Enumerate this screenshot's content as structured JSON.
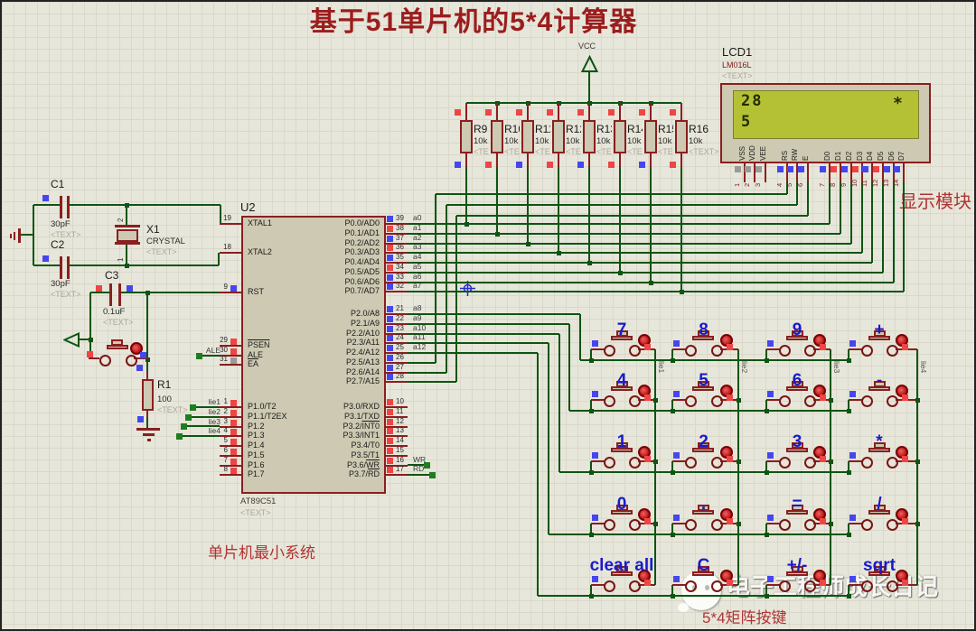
{
  "title": "基于51单片机的5*4计算器",
  "captions": {
    "display_module": "显示模块",
    "mcu_system": "单片机最小系统",
    "keypad": "5*4矩阵按键"
  },
  "watermark": "电子工程师成长日记",
  "power": {
    "vcc": "VCC"
  },
  "lcd": {
    "ref": "LCD1",
    "model": "LM016L",
    "placeholder": "<TEXT>",
    "screen": {
      "line1": "28",
      "line2": "5",
      "symbol": "*"
    },
    "pins": [
      {
        "num": "1",
        "name": "VSS",
        "marker": "gray"
      },
      {
        "num": "2",
        "name": "VDD",
        "marker": "gray"
      },
      {
        "num": "3",
        "name": "VEE",
        "marker": "gray"
      },
      {
        "num": "4",
        "name": "RS",
        "marker": "blue"
      },
      {
        "num": "5",
        "name": "RW",
        "marker": "blue"
      },
      {
        "num": "6",
        "name": "E",
        "marker": "blue"
      },
      {
        "num": "7",
        "name": "D0",
        "marker": "blue"
      },
      {
        "num": "8",
        "name": "D1",
        "marker": "red"
      },
      {
        "num": "9",
        "name": "D2",
        "marker": "blue"
      },
      {
        "num": "10",
        "name": "D3",
        "marker": "red"
      },
      {
        "num": "11",
        "name": "D4",
        "marker": "blue"
      },
      {
        "num": "12",
        "name": "D5",
        "marker": "red"
      },
      {
        "num": "13",
        "name": "D6",
        "marker": "blue"
      },
      {
        "num": "14",
        "name": "D7",
        "marker": "blue"
      }
    ]
  },
  "resistor_bank": {
    "value": "10k",
    "placeholder": "<TEXT>",
    "top_marker": "red",
    "items": [
      {
        "ref": "R9",
        "bottom_marker": "blue"
      },
      {
        "ref": "R10",
        "bottom_marker": "red"
      },
      {
        "ref": "R11",
        "bottom_marker": "blue"
      },
      {
        "ref": "R12",
        "bottom_marker": "red"
      },
      {
        "ref": "R13",
        "bottom_marker": "blue"
      },
      {
        "ref": "R14",
        "bottom_marker": "red"
      },
      {
        "ref": "R15",
        "bottom_marker": "blue"
      },
      {
        "ref": "R16",
        "bottom_marker": "red"
      }
    ]
  },
  "mcu": {
    "ref": "U2",
    "part": "AT89C51",
    "placeholder": "<TEXT>",
    "left_pins": [
      {
        "num": "19",
        "name": "XTAL1"
      },
      {
        "num": "18",
        "name": "XTAL2"
      },
      {
        "num": "9",
        "name": "RST",
        "marker": "blue"
      },
      {
        "num": "29",
        "name": "PSEN",
        "overline": true,
        "marker": "red"
      },
      {
        "num": "30",
        "name": "ALE",
        "marker": "red",
        "net": "ALE"
      },
      {
        "num": "31",
        "name": "EA",
        "overline": true,
        "marker": "gray"
      },
      {
        "num": "1",
        "name": "P1.0/T2",
        "marker": "red",
        "net": "lie1"
      },
      {
        "num": "2",
        "name": "P1.1/T2EX",
        "marker": "red",
        "net": "lie2"
      },
      {
        "num": "3",
        "name": "P1.2",
        "marker": "red",
        "net": "lie3"
      },
      {
        "num": "4",
        "name": "P1.3",
        "marker": "red",
        "net": "lie4"
      },
      {
        "num": "5",
        "name": "P1.4",
        "marker": "red"
      },
      {
        "num": "6",
        "name": "P1.5",
        "marker": "red"
      },
      {
        "num": "7",
        "name": "P1.6",
        "marker": "red"
      },
      {
        "num": "8",
        "name": "P1.7",
        "marker": "red"
      }
    ],
    "right_pins": [
      {
        "num": "39",
        "name": "P0.0/AD0",
        "marker": "blue",
        "net": "a0"
      },
      {
        "num": "38",
        "name": "P0.1/AD1",
        "marker": "red",
        "net": "a1"
      },
      {
        "num": "37",
        "name": "P0.2/AD2",
        "marker": "blue",
        "net": "a2"
      },
      {
        "num": "36",
        "name": "P0.3/AD3",
        "marker": "red",
        "net": "a3"
      },
      {
        "num": "35",
        "name": "P0.4/AD4",
        "marker": "blue",
        "net": "a4"
      },
      {
        "num": "34",
        "name": "P0.5/AD5",
        "marker": "red",
        "net": "a5"
      },
      {
        "num": "33",
        "name": "P0.6/AD6",
        "marker": "blue",
        "net": "a6"
      },
      {
        "num": "32",
        "name": "P0.7/AD7",
        "marker": "blue",
        "net": "a7"
      },
      {
        "num": "21",
        "name": "P2.0/A8",
        "marker": "blue",
        "net": "a8"
      },
      {
        "num": "22",
        "name": "P2.1/A9",
        "marker": "blue",
        "net": "a9"
      },
      {
        "num": "23",
        "name": "P2.2/A10",
        "marker": "blue",
        "net": "a10"
      },
      {
        "num": "24",
        "name": "P2.3/A11",
        "marker": "blue",
        "net": "a11"
      },
      {
        "num": "25",
        "name": "P2.4/A12",
        "marker": "blue",
        "net": "a12"
      },
      {
        "num": "26",
        "name": "P2.5/A13",
        "marker": "blue"
      },
      {
        "num": "27",
        "name": "P2.6/A14",
        "marker": "blue"
      },
      {
        "num": "28",
        "name": "P2.7/A15",
        "marker": "blue"
      },
      {
        "num": "10",
        "name": "P3.0/RXD",
        "marker": "red"
      },
      {
        "num": "11",
        "name": "P3.1/TXD",
        "marker": "red"
      },
      {
        "num": "12",
        "name": "P3.2/INT0",
        "overline_suffix": "INT0",
        "marker": "red"
      },
      {
        "num": "13",
        "name": "P3.3/INT1",
        "marker": "red"
      },
      {
        "num": "14",
        "name": "P3.4/T0",
        "marker": "red"
      },
      {
        "num": "15",
        "name": "P3.5/T1",
        "marker": "red"
      },
      {
        "num": "16",
        "name": "P3.6/WR",
        "overline_suffix": "WR",
        "marker": "red",
        "net": "WR"
      },
      {
        "num": "17",
        "name": "P3.7/RD",
        "overline_suffix": "RD",
        "marker": "red",
        "net": "RD"
      }
    ]
  },
  "oscillator": {
    "c1": {
      "ref": "C1",
      "value": "30pF",
      "placeholder": "<TEXT>"
    },
    "c2": {
      "ref": "C2",
      "value": "30pF",
      "placeholder": "<TEXT>"
    },
    "x1": {
      "ref": "X1",
      "value": "CRYSTAL",
      "placeholder": "<TEXT>",
      "pin_top": "2",
      "pin_bottom": "1"
    }
  },
  "reset": {
    "c3": {
      "ref": "C3",
      "value": "0.1uF",
      "placeholder": "<TEXT>"
    },
    "r1": {
      "ref": "R1",
      "value": "100",
      "placeholder": "<TEXT>"
    }
  },
  "keypad": {
    "rows": [
      [
        "7",
        "8",
        "9",
        "+"
      ],
      [
        "4",
        "5",
        "6",
        "-"
      ],
      [
        "1",
        "2",
        "3",
        "*"
      ],
      [
        "0",
        ".",
        "=",
        "/"
      ],
      [
        "clear all",
        "C",
        "+/-",
        "sqrt"
      ]
    ],
    "column_nets": [
      "lie1",
      "lie2",
      "lie3",
      "lie4"
    ]
  },
  "colors": {
    "wire": "#0d5513",
    "component": "#8a1f1f",
    "key_label": "#1a1acd",
    "caption": "#b03434",
    "title": "#9b1d1d",
    "marker_red": "#ee4545",
    "marker_blue": "#4646ee",
    "marker_gray": "#9a9a9a",
    "lcd_screen": "#b5c135"
  }
}
